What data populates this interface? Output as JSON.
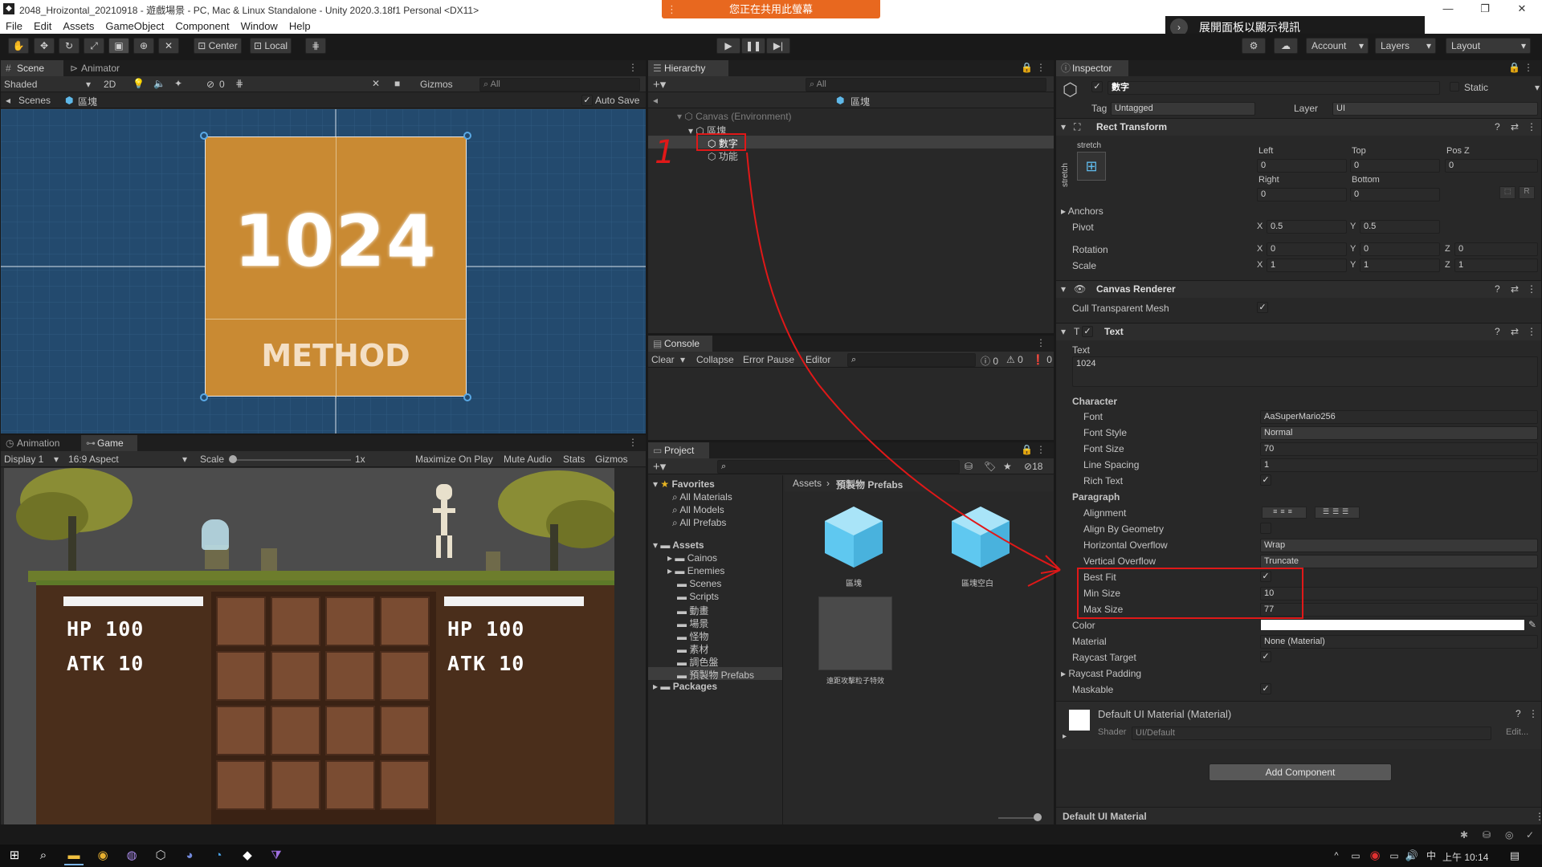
{
  "window": {
    "title": "2048_Hroizontal_20210918 - 遊戲場景 - PC, Mac & Linux Standalone - Unity 2020.3.18f1 Personal <DX11>"
  },
  "menu": [
    "File",
    "Edit",
    "Assets",
    "GameObject",
    "Component",
    "Window",
    "Help"
  ],
  "share_banner": "您正在共用此螢幕",
  "expand_panel": "展開面板以顯示視訊",
  "toolbar": {
    "center": "Center",
    "local": "Local",
    "account": "Account",
    "layers": "Layers",
    "layout": "Layout"
  },
  "scene": {
    "tab_scene": "Scene",
    "tab_animator": "Animator",
    "shaded": "Shaded",
    "mode_2d": "2D",
    "fx_count": "0",
    "gizmos": "Gizmos",
    "search": "All",
    "breadcrumb_root": "Scenes",
    "breadcrumb_obj": "區塊",
    "auto_save": "Auto Save",
    "card_number": "1024",
    "card_label": "METHOD"
  },
  "game": {
    "tab_animation": "Animation",
    "tab_game": "Game",
    "display": "Display 1",
    "aspect": "16:9 Aspect",
    "scale_label": "Scale",
    "scale_value": "1x",
    "maximize": "Maximize On Play",
    "mute": "Mute Audio",
    "stats": "Stats",
    "gizmos": "Gizmos",
    "left_hp": "HP 100",
    "left_atk": "ATK 10",
    "right_hp": "HP 100",
    "right_atk": "ATK 10"
  },
  "hierarchy": {
    "tab": "Hierarchy",
    "search": "All",
    "header": "區塊",
    "items": [
      {
        "label": "Canvas (Environment)",
        "depth": 0,
        "dim": true
      },
      {
        "label": "區塊",
        "depth": 1
      },
      {
        "label": "數字",
        "depth": 2,
        "selected": true
      },
      {
        "label": "功能",
        "depth": 2
      }
    ],
    "annotation_number": "1"
  },
  "console": {
    "tab": "Console",
    "clear": "Clear",
    "collapse": "Collapse",
    "error_pause": "Error Pause",
    "editor": "Editor",
    "count_info": "0",
    "count_warn": "0",
    "count_err": "0"
  },
  "project": {
    "tab": "Project",
    "hidden_count": "18",
    "favorites_label": "Favorites",
    "favorites": [
      "All Materials",
      "All Models",
      "All Prefabs"
    ],
    "assets_label": "Assets",
    "assets": [
      "Cainos",
      "Enemies",
      "Scenes",
      "Scripts",
      "動畫",
      "場景",
      "怪物",
      "素材",
      "調色盤",
      "預製物 Prefabs"
    ],
    "packages_label": "Packages",
    "breadcrumb_root": "Assets",
    "breadcrumb_folder": "預製物 Prefabs",
    "grid": [
      "區塊",
      "區塊空白",
      "遠距攻擊粒子特效"
    ]
  },
  "inspector": {
    "tab": "Inspector",
    "object_name": "數字",
    "static": "Static",
    "tag_label": "Tag",
    "tag_value": "Untagged",
    "layer_label": "Layer",
    "layer_value": "UI",
    "rect_transform": {
      "title": "Rect Transform",
      "stretch_top": "stretch",
      "stretch_side": "stretch",
      "left_label": "Left",
      "left": "0",
      "top_label": "Top",
      "top": "0",
      "posz_label": "Pos Z",
      "posz": "0",
      "right_label": "Right",
      "right": "0",
      "bottom_label": "Bottom",
      "bottom": "0",
      "anchors": "Anchors",
      "pivot_label": "Pivot",
      "pivot_x": "0.5",
      "pivot_y": "0.5",
      "rotation_label": "Rotation",
      "rot_x": "0",
      "rot_y": "0",
      "rot_z": "0",
      "scale_label": "Scale",
      "scale_x": "1",
      "scale_y": "1",
      "scale_z": "1",
      "x": "X",
      "y": "Y",
      "z": "Z",
      "r": "R"
    },
    "canvas_renderer": {
      "title": "Canvas Renderer",
      "cull_label": "Cull Transparent Mesh"
    },
    "text": {
      "title": "Text",
      "text_label": "Text",
      "text_value": "1024",
      "character": "Character",
      "font_label": "Font",
      "font_value": "SuperMario256",
      "font_style_label": "Font Style",
      "font_style_value": "Normal",
      "font_size_label": "Font Size",
      "font_size_value": "70",
      "line_spacing_label": "Line Spacing",
      "line_spacing_value": "1",
      "rich_text_label": "Rich Text",
      "paragraph": "Paragraph",
      "alignment_label": "Alignment",
      "align_geom_label": "Align By Geometry",
      "h_overflow_label": "Horizontal Overflow",
      "h_overflow_value": "Wrap",
      "v_overflow_label": "Vertical Overflow",
      "v_overflow_value": "Truncate",
      "best_fit_label": "Best Fit",
      "min_size_label": "Min Size",
      "min_size_value": "10",
      "max_size_label": "Max Size",
      "max_size_value": "77",
      "color_label": "Color",
      "material_label": "Material",
      "material_value": "None (Material)",
      "raycast_label": "Raycast Target",
      "raycast_padding_label": "Raycast Padding",
      "maskable_label": "Maskable"
    },
    "material": {
      "name": "Default UI Material (Material)",
      "shader_label": "Shader",
      "shader_value": "UI/Default",
      "edit": "Edit..."
    },
    "add_component": "Add Component",
    "footer": "Default UI Material"
  },
  "taskbar": {
    "ime": "中",
    "time": "上午 10:14"
  },
  "colors": {
    "accent_orange": "#e8681f",
    "annotation_red": "#e01818",
    "card_fill": "#c98a33",
    "selection": "#2c5d87"
  }
}
